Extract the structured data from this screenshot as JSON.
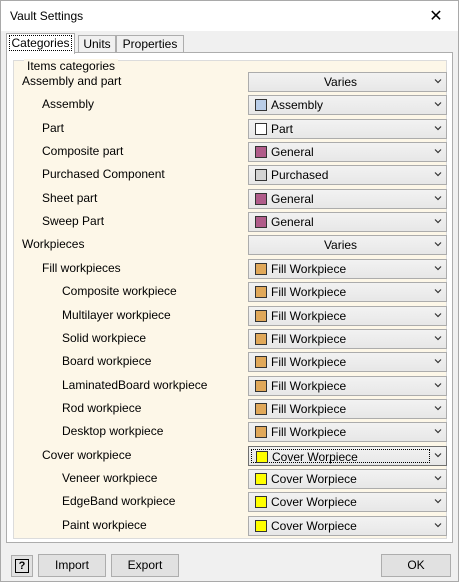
{
  "window": {
    "title": "Vault Settings",
    "close_glyph": "✕"
  },
  "tabs": [
    {
      "label": "Categories",
      "active": true
    },
    {
      "label": "Units",
      "active": false
    },
    {
      "label": "Properties",
      "active": false
    }
  ],
  "group": {
    "caption": "Items categories"
  },
  "rows": [
    {
      "label": "Assembly and part",
      "level": 0,
      "value": "Varies",
      "swatch": null
    },
    {
      "label": "Assembly",
      "level": 1,
      "value": "Assembly",
      "swatch": "#b9cde8"
    },
    {
      "label": "Part",
      "level": 1,
      "value": "Part",
      "swatch": "#ffffff"
    },
    {
      "label": "Composite part",
      "level": 1,
      "value": "General",
      "swatch": "#b05c8a"
    },
    {
      "label": "Purchased Component",
      "level": 1,
      "value": "Purchased",
      "swatch": "#d3d3d3"
    },
    {
      "label": "Sheet part",
      "level": 1,
      "value": "General",
      "swatch": "#b05c8a"
    },
    {
      "label": "Sweep Part",
      "level": 1,
      "value": "General",
      "swatch": "#b05c8a"
    },
    {
      "label": "Workpieces",
      "level": 0,
      "value": "Varies",
      "swatch": null
    },
    {
      "label": "Fill workpieces",
      "level": 1,
      "value": "Fill Workpiece",
      "swatch": "#e0a85a"
    },
    {
      "label": "Composite workpiece",
      "level": 2,
      "value": "Fill Workpiece",
      "swatch": "#e0a85a"
    },
    {
      "label": "Multilayer workpiece",
      "level": 2,
      "value": "Fill Workpiece",
      "swatch": "#e0a85a"
    },
    {
      "label": "Solid workpiece",
      "level": 2,
      "value": "Fill Workpiece",
      "swatch": "#e0a85a"
    },
    {
      "label": "Board workpiece",
      "level": 2,
      "value": "Fill Workpiece",
      "swatch": "#e0a85a"
    },
    {
      "label": "LaminatedBoard workpiece",
      "level": 2,
      "value": "Fill Workpiece",
      "swatch": "#e0a85a"
    },
    {
      "label": "Rod workpiece",
      "level": 2,
      "value": "Fill Workpiece",
      "swatch": "#e0a85a"
    },
    {
      "label": "Desktop workpiece",
      "level": 2,
      "value": "Fill Workpiece",
      "swatch": "#e0a85a"
    },
    {
      "label": "Cover workpiece",
      "level": 1,
      "value": "Cover Worpiece",
      "swatch": "#ffff00",
      "focused": true
    },
    {
      "label": "Veneer workpiece",
      "level": 2,
      "value": "Cover Worpiece",
      "swatch": "#ffff00"
    },
    {
      "label": "EdgeBand workpiece",
      "level": 2,
      "value": "Cover Worpiece",
      "swatch": "#ffff00"
    },
    {
      "label": "Paint workpiece",
      "level": 2,
      "value": "Cover Worpiece",
      "swatch": "#ffff00"
    }
  ],
  "footer": {
    "help_glyph": "?",
    "import_label": "Import",
    "export_label": "Export",
    "ok_label": "OK"
  },
  "icons": {
    "chevron": "chevron-down-icon",
    "help": "help-icon",
    "close": "close-icon"
  }
}
